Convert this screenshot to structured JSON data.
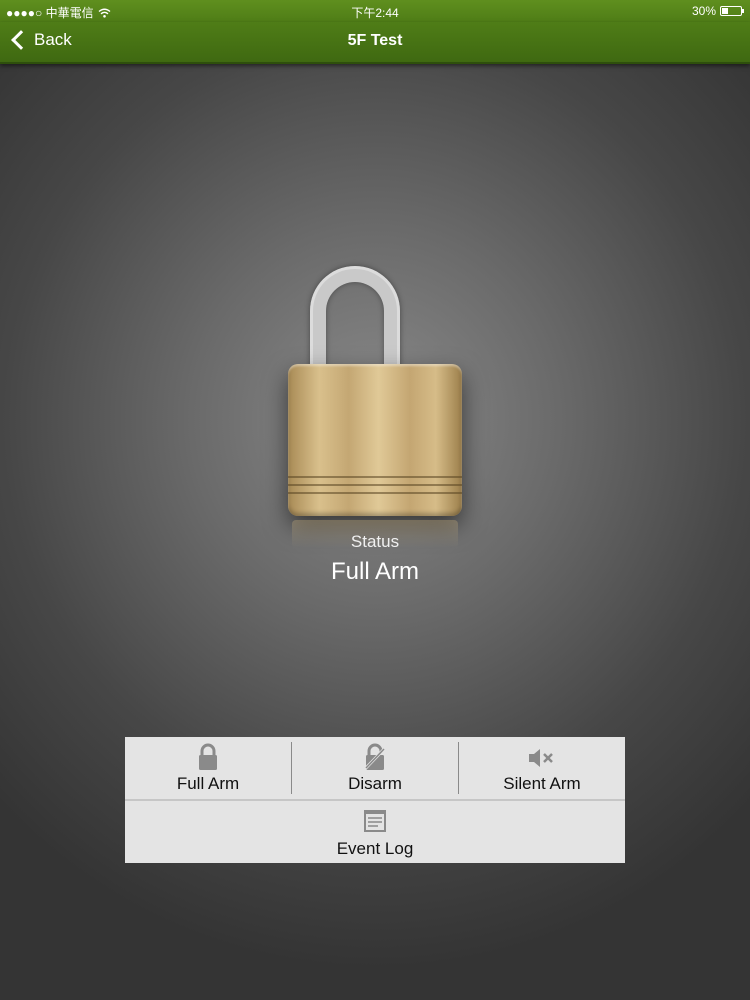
{
  "status_bar": {
    "carrier": "●●●●○ 中華電信",
    "time": "下午2:44",
    "battery": "30%"
  },
  "nav": {
    "back_label": "Back",
    "title": "5F Test"
  },
  "status": {
    "label": "Status",
    "value": "Full Arm"
  },
  "actions": {
    "full_arm": "Full Arm",
    "disarm": "Disarm",
    "silent_arm": "Silent Arm",
    "event_log": "Event Log"
  },
  "colors": {
    "nav_green": "#4f7d17",
    "panel_bg": "#e4e4e4",
    "icon_gray": "#8a8a8a",
    "brass": "#d9c08c"
  },
  "icons": {
    "padlock": "padlock-icon",
    "full_arm": "lock-icon",
    "disarm": "unlocked-slash-icon",
    "silent_arm": "mute-speaker-icon",
    "event_log": "document-list-icon"
  }
}
